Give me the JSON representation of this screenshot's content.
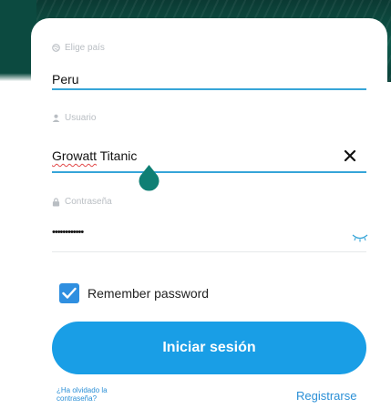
{
  "country": {
    "label": "Elige país",
    "value": "Peru"
  },
  "username": {
    "label": "Usuario",
    "value_misspelled": "Growatt",
    "value_rest": " Titanic"
  },
  "password": {
    "label": "Contraseña",
    "value": "••••••••••••"
  },
  "remember": {
    "label": "Remember password",
    "checked": true
  },
  "login_button": {
    "label": "Iniciar sesión"
  },
  "forgot_link": {
    "label": "¿Ha olvidado la contraseña?"
  },
  "register_link": {
    "label": "Registrarse"
  },
  "colors": {
    "accent": "#199ee6",
    "underline": "#36a5d8",
    "handle": "#0f7f74",
    "checkbox": "#2f8fe0"
  },
  "icons": [
    "globe-icon",
    "user-icon",
    "lock-icon",
    "clear-icon",
    "eye-closed-icon",
    "checkmark-icon"
  ]
}
